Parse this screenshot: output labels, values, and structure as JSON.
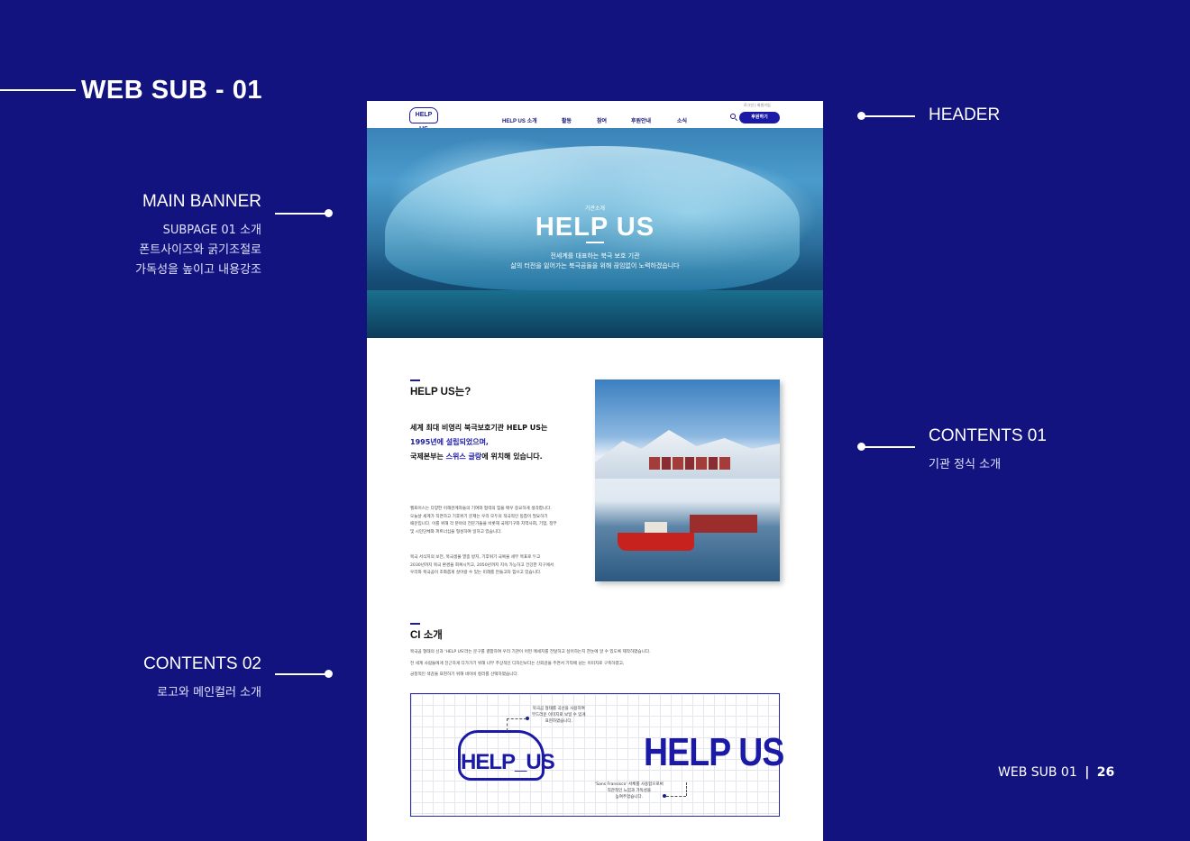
{
  "page_title": "WEB SUB - 01",
  "annotations": {
    "main_banner": {
      "title": "MAIN BANNER",
      "lines": [
        "SUBPAGE 01 소개",
        "폰트사이즈와 굵기조절로",
        "가독성을 높이고 내용강조"
      ]
    },
    "header": {
      "title": "HEADER"
    },
    "contents01": {
      "title": "CONTENTS 01",
      "sub": "기관 정식 소개"
    },
    "contents02": {
      "title": "CONTENTS 02",
      "sub": "로고와 메인컬러 소개"
    }
  },
  "mockup": {
    "header": {
      "logo": "HELP US",
      "nav": [
        "HELP US 소개",
        "활동",
        "참여",
        "후원안내",
        "소식"
      ],
      "util": "로그인 | 회원가입",
      "donate_button": "후원하기"
    },
    "banner": {
      "tag": "기관소개",
      "title": "HELP US",
      "desc_line1": "전세계를 대표하는 북극 보호 기관",
      "desc_line2": "삶의 터전을 잃어가는 북극곰들을 위해 끊임없이 노력하겠습니다"
    },
    "about": {
      "title": "HELP US는?",
      "lead_line1": "세계 최대 비영리 북극보호기관 HELP US는",
      "lead_hl1": "1995년에 설립되었으며,",
      "lead_line3_pre": "국제본부는 ",
      "lead_hl2": "스위스 글랑",
      "lead_line3_post": "에 위치해 있습니다.",
      "para1": [
        "헬프어스는 다양한 이해관계자들의 기여와 협력의 힘을 매우 중요하게 생각합니다.",
        "오늘날 세계가 직면하고 기후위기 문제는 우리 모두의 적극적인 동참이 필요하기",
        "때문입니다. 이를 위해 각 분야의 전문가들을 비롯해 국제기구와 지역사회, 기업, 정부",
        "및 시민단체와 파트너십을 형성하여 일하고 있습니다."
      ],
      "para2": [
        "북극 서식지의 보전, 북극생물 멸종 방지, 기후위기 극복을 세부 목표로 두고",
        "2030년까지 북극 환경을 회복시키고, 2050년까지 지속 가능하고 건강한 지구에서",
        "우리와 북극곰이 조화롭게 살아갈 수 있는 미래를 만들고자 힘쓰고 있습니다."
      ]
    },
    "ci": {
      "title": "CI 소개",
      "desc": [
        "북극곰 형태의 선과 'HELP US'라는 문구를 결합하여 우리 기관이 어떤 메세지를 전달하고 싶어하는지 한눈에 알 수 있도록 제작하였습니다.",
        "전 세계 사람들에게 친근하게 다가가기 위해 너무 추상적인 디자인보다는 신뢰감을 주면서 기억에 남는 이미지로 구축하였고,",
        "긍정적인 색감을 표현하기 위해 네이비 컬러를 선택하였습니다."
      ],
      "logo_text": "HELP_US",
      "wordmark": "HELP US",
      "note1": [
        "북극곰 형태를 곡선을 사용하여",
        "부드러운 이미지로 보일 수 있게",
        "표현하였습니다."
      ],
      "note2": [
        "'Sans Fransisco' 서체를 사용함으로써",
        "직관적인 느낌과 가독성을",
        "높여주었습니다."
      ]
    }
  },
  "footer": {
    "label": "WEB SUB 01",
    "separator": "|",
    "page_number": "26"
  },
  "colors": {
    "background": "#12137f",
    "brand": "#1a1aa6"
  }
}
